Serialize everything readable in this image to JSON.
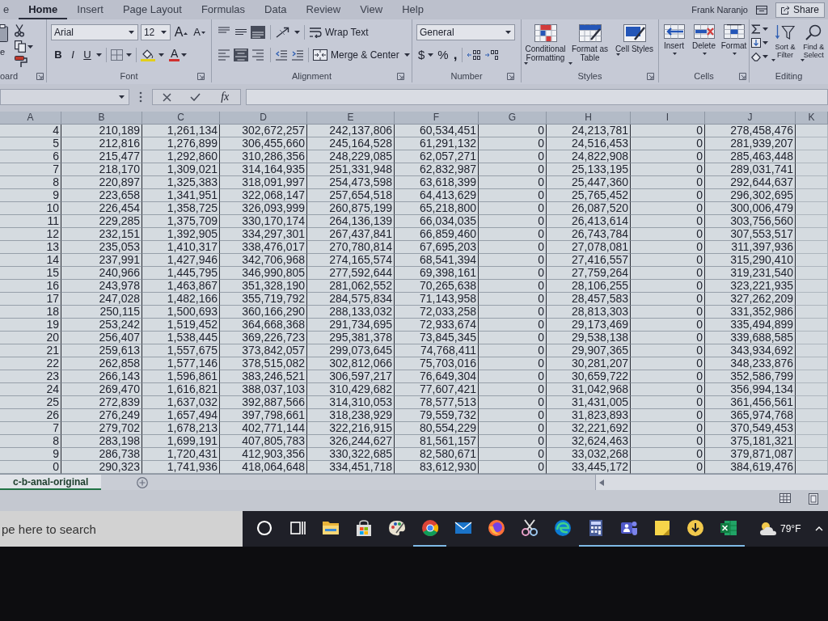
{
  "ribbon_tabs": [
    {
      "label": "e",
      "selected": false
    },
    {
      "label": "Home",
      "selected": true
    },
    {
      "label": "Insert",
      "selected": false
    },
    {
      "label": "Page Layout",
      "selected": false
    },
    {
      "label": "Formulas",
      "selected": false
    },
    {
      "label": "Data",
      "selected": false
    },
    {
      "label": "Review",
      "selected": false
    },
    {
      "label": "View",
      "selected": false
    },
    {
      "label": "Help",
      "selected": false
    }
  ],
  "account": {
    "user": "Frank Naranjo"
  },
  "share_button": {
    "label": "Share"
  },
  "ribbon": {
    "clipboard": {
      "paste_label": "e",
      "group_label": "oard"
    },
    "font": {
      "font_name": "Arial",
      "font_size": "12",
      "grow_font": "A",
      "shrink_font": "A",
      "bold": "B",
      "italic": "I",
      "underline": "U",
      "font_color": "A",
      "group_label": "Font"
    },
    "alignment": {
      "vertical_align": [
        {
          "kind": "top",
          "selected": false
        },
        {
          "kind": "middle",
          "selected": false
        },
        {
          "kind": "bottom",
          "selected": true
        }
      ],
      "horizontal_align": [
        {
          "kind": "left",
          "selected": false
        },
        {
          "kind": "center",
          "selected": true
        },
        {
          "kind": "right",
          "selected": false
        }
      ],
      "wrap_text": "Wrap Text",
      "merge_center": "Merge & Center",
      "group_label": "Alignment"
    },
    "number": {
      "format": "General",
      "currency": "$",
      "percent": "%",
      "comma": ",",
      "group_label": "Number"
    },
    "styles": {
      "buttons": [
        {
          "kind": "conditional",
          "label": "Conditional Formatting"
        },
        {
          "kind": "table",
          "label": "Format as Table"
        },
        {
          "kind": "cellstyles",
          "label": "Cell Styles"
        }
      ],
      "group_label": "Styles"
    },
    "cells": {
      "buttons": [
        {
          "kind": "insert",
          "label": "Insert"
        },
        {
          "kind": "delete",
          "label": "Delete"
        },
        {
          "kind": "format",
          "label": "Format"
        }
      ],
      "group_label": "Cells"
    },
    "editing": {
      "buttons": [
        {
          "kind": "sort",
          "label": "Sort & Filter"
        },
        {
          "kind": "find",
          "label": "Find & Select"
        }
      ],
      "group_label": "Editing"
    }
  },
  "formula_bar": {
    "function_label": "fx"
  },
  "sheet": {
    "columns": [
      "A",
      "B",
      "C",
      "D",
      "E",
      "F",
      "G",
      "H",
      "I",
      "J",
      "K"
    ],
    "rows": [
      [
        "4",
        "210,189",
        "1,261,134",
        "302,672,257",
        "242,137,806",
        "60,534,451",
        "0",
        "24,213,781",
        "0",
        "278,458,476"
      ],
      [
        "5",
        "212,816",
        "1,276,899",
        "306,455,660",
        "245,164,528",
        "61,291,132",
        "0",
        "24,516,453",
        "0",
        "281,939,207"
      ],
      [
        "6",
        "215,477",
        "1,292,860",
        "310,286,356",
        "248,229,085",
        "62,057,271",
        "0",
        "24,822,908",
        "0",
        "285,463,448"
      ],
      [
        "7",
        "218,170",
        "1,309,021",
        "314,164,935",
        "251,331,948",
        "62,832,987",
        "0",
        "25,133,195",
        "0",
        "289,031,741"
      ],
      [
        "8",
        "220,897",
        "1,325,383",
        "318,091,997",
        "254,473,598",
        "63,618,399",
        "0",
        "25,447,360",
        "0",
        "292,644,637"
      ],
      [
        "9",
        "223,658",
        "1,341,951",
        "322,068,147",
        "257,654,518",
        "64,413,629",
        "0",
        "25,765,452",
        "0",
        "296,302,695"
      ],
      [
        "10",
        "226,454",
        "1,358,725",
        "326,093,999",
        "260,875,199",
        "65,218,800",
        "0",
        "26,087,520",
        "0",
        "300,006,479"
      ],
      [
        "11",
        "229,285",
        "1,375,709",
        "330,170,174",
        "264,136,139",
        "66,034,035",
        "0",
        "26,413,614",
        "0",
        "303,756,560"
      ],
      [
        "12",
        "232,151",
        "1,392,905",
        "334,297,301",
        "267,437,841",
        "66,859,460",
        "0",
        "26,743,784",
        "0",
        "307,553,517"
      ],
      [
        "13",
        "235,053",
        "1,410,317",
        "338,476,017",
        "270,780,814",
        "67,695,203",
        "0",
        "27,078,081",
        "0",
        "311,397,936"
      ],
      [
        "14",
        "237,991",
        "1,427,946",
        "342,706,968",
        "274,165,574",
        "68,541,394",
        "0",
        "27,416,557",
        "0",
        "315,290,410"
      ],
      [
        "15",
        "240,966",
        "1,445,795",
        "346,990,805",
        "277,592,644",
        "69,398,161",
        "0",
        "27,759,264",
        "0",
        "319,231,540"
      ],
      [
        "16",
        "243,978",
        "1,463,867",
        "351,328,190",
        "281,062,552",
        "70,265,638",
        "0",
        "28,106,255",
        "0",
        "323,221,935"
      ],
      [
        "17",
        "247,028",
        "1,482,166",
        "355,719,792",
        "284,575,834",
        "71,143,958",
        "0",
        "28,457,583",
        "0",
        "327,262,209"
      ],
      [
        "18",
        "250,115",
        "1,500,693",
        "360,166,290",
        "288,133,032",
        "72,033,258",
        "0",
        "28,813,303",
        "0",
        "331,352,986"
      ],
      [
        "19",
        "253,242",
        "1,519,452",
        "364,668,368",
        "291,734,695",
        "72,933,674",
        "0",
        "29,173,469",
        "0",
        "335,494,899"
      ],
      [
        "20",
        "256,407",
        "1,538,445",
        "369,226,723",
        "295,381,378",
        "73,845,345",
        "0",
        "29,538,138",
        "0",
        "339,688,585"
      ],
      [
        "21",
        "259,613",
        "1,557,675",
        "373,842,057",
        "299,073,645",
        "74,768,411",
        "0",
        "29,907,365",
        "0",
        "343,934,692"
      ],
      [
        "22",
        "262,858",
        "1,577,146",
        "378,515,082",
        "302,812,066",
        "75,703,016",
        "0",
        "30,281,207",
        "0",
        "348,233,876"
      ],
      [
        "23",
        "266,143",
        "1,596,861",
        "383,246,521",
        "306,597,217",
        "76,649,304",
        "0",
        "30,659,722",
        "0",
        "352,586,799"
      ],
      [
        "24",
        "269,470",
        "1,616,821",
        "388,037,103",
        "310,429,682",
        "77,607,421",
        "0",
        "31,042,968",
        "0",
        "356,994,134"
      ],
      [
        "25",
        "272,839",
        "1,637,032",
        "392,887,566",
        "314,310,053",
        "78,577,513",
        "0",
        "31,431,005",
        "0",
        "361,456,561"
      ],
      [
        "26",
        "276,249",
        "1,657,494",
        "397,798,661",
        "318,238,929",
        "79,559,732",
        "0",
        "31,823,893",
        "0",
        "365,974,768"
      ],
      [
        "7",
        "279,702",
        "1,678,213",
        "402,771,144",
        "322,216,915",
        "80,554,229",
        "0",
        "32,221,692",
        "0",
        "370,549,453"
      ],
      [
        "8",
        "283,198",
        "1,699,191",
        "407,805,783",
        "326,244,627",
        "81,561,157",
        "0",
        "32,624,463",
        "0",
        "375,181,321"
      ],
      [
        "9",
        "286,738",
        "1,720,431",
        "412,903,356",
        "330,322,685",
        "82,580,671",
        "0",
        "33,032,268",
        "0",
        "379,871,087"
      ],
      [
        "0",
        "290,323",
        "1,741,936",
        "418,064,648",
        "334,451,718",
        "83,612,930",
        "0",
        "33,445,172",
        "0",
        "384,619,476"
      ]
    ]
  },
  "sheet_tabs": [
    {
      "label": "c-b-anal-original",
      "selected": true
    }
  ],
  "taskbar": {
    "search": {
      "placeholder": "pe here to search"
    },
    "apps": [
      {
        "kind": "circle",
        "running": false
      },
      {
        "kind": "taskview",
        "running": false
      },
      {
        "kind": "folder",
        "running": false
      },
      {
        "kind": "store",
        "running": false
      },
      {
        "kind": "palette",
        "running": false
      },
      {
        "kind": "wheel",
        "running": true
      },
      {
        "kind": "mail",
        "running": false
      },
      {
        "kind": "orb",
        "running": false
      },
      {
        "kind": "scissors",
        "running": false
      },
      {
        "kind": "swirl",
        "running": false
      },
      {
        "kind": "calculator",
        "running": true
      },
      {
        "kind": "people",
        "running": true
      },
      {
        "kind": "note",
        "running": true
      },
      {
        "kind": "download",
        "running": true
      },
      {
        "kind": "sheet",
        "running": true
      }
    ],
    "weather": "79°F"
  }
}
